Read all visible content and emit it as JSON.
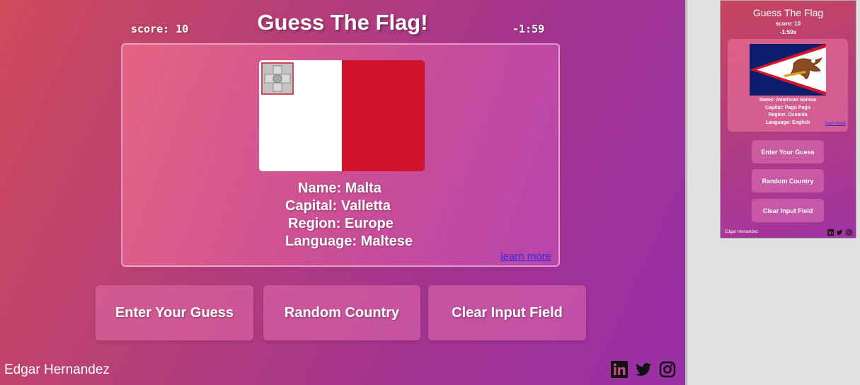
{
  "main": {
    "title": "Guess The Flag!",
    "score": "score: 10",
    "timer": "-1:59",
    "country": {
      "name": "Name: Malta",
      "capital": "Capital: Valletta",
      "region": "Region: Europe",
      "language": "Language: Maltese"
    },
    "learn_more": "learn more",
    "buttons": {
      "enter": "Enter Your Guess",
      "random": "Random Country",
      "clear": "Clear Input Field"
    },
    "footer_name": "Edgar Hernandez",
    "social_icons": [
      "linkedin-icon",
      "twitter-icon",
      "instagram-icon"
    ]
  },
  "mobile": {
    "title": "Guess The Flag",
    "score": "score: 10",
    "timer": "-1:59s",
    "country": {
      "name": "Name: American Samoa",
      "capital": "Capital: Pago Pago",
      "region": "Region: Oceania",
      "language": "Language: English"
    },
    "learn_more": "learn more",
    "buttons": {
      "enter": "Enter Your Guess",
      "random": "Random Country",
      "clear": "Clear Input Field"
    },
    "footer_name": "Edgar Hernandez"
  },
  "colors": {
    "malta_white": "#ffffff",
    "malta_red": "#cf142b",
    "link": "#3a2ad6"
  }
}
